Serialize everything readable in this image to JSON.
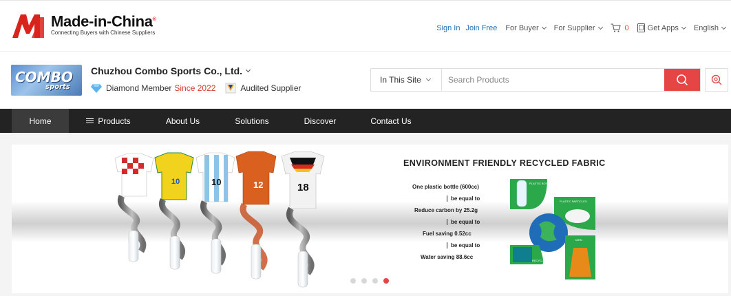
{
  "header": {
    "brand": "Made-in-China",
    "tagline": "Connecting Buyers with Chinese Suppliers",
    "registered": "®",
    "nav": {
      "sign_in": "Sign In",
      "join_free": "Join Free",
      "for_buyer": "For Buyer",
      "for_supplier": "For Supplier",
      "cart_count": "0",
      "get_apps": "Get Apps",
      "language": "English"
    }
  },
  "supplier": {
    "logo_text": "COMBO",
    "logo_sub": "sports",
    "name": "Chuzhou Combo Sports Co., Ltd.",
    "membership": "Diamond Member",
    "since": "Since 2022",
    "audited": "Audited Supplier"
  },
  "search": {
    "scope": "In This Site",
    "placeholder": "Search Products"
  },
  "main_nav": [
    "Home",
    "Products",
    "About Us",
    "Solutions",
    "Discover",
    "Contact Us"
  ],
  "banner": {
    "title": "ENVIRONMENT FRIENDLY RECYCLED FABRIC",
    "facts": [
      "One plastic bottle (600cc)",
      "be equal to",
      "Reduce carbon by 25.2g",
      "be equal to",
      "Fuel saving 0.52cc",
      "be equal to",
      "Water saving 88.6cc"
    ],
    "jersey_numbers": [
      "10",
      "10",
      "12",
      "18"
    ],
    "icon_labels": [
      "PLASTIC BOTTLE",
      "PLASTIC PARTICLES",
      "YARN",
      "RECYCLED FABRIC"
    ],
    "active_slide": 4,
    "slide_count": 4
  },
  "colors": {
    "accent": "#e64545",
    "link": "#1f6fb2",
    "nav_bg": "#232323"
  }
}
